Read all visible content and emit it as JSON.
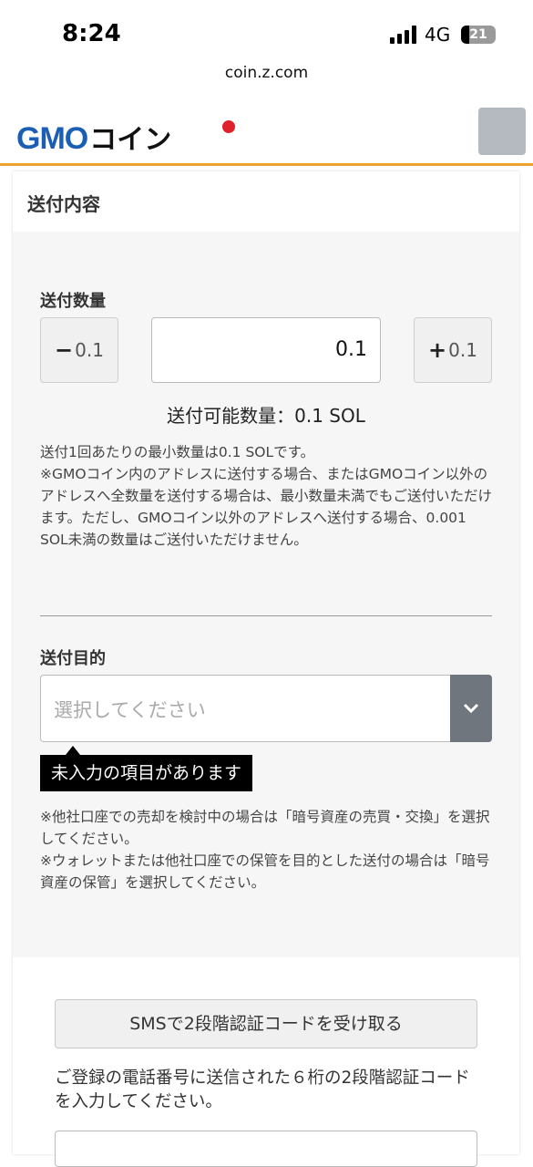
{
  "status_bar": {
    "time": "8:24",
    "network": "4G",
    "battery": "21"
  },
  "browser": {
    "url": "coin.z.com"
  },
  "header": {
    "logo_gmo": "GMO",
    "logo_coin": "コイン"
  },
  "card": {
    "title": "送付内容"
  },
  "quantity": {
    "label": "送付数量",
    "minus_label": "0.1",
    "plus_label": "0.1",
    "value": "0.1",
    "available": "送付可能数量：0.1 SOL"
  },
  "notes": {
    "min_quantity": "送付1回あたりの最小数量は0.1 SOLです。\n※GMOコイン内のアドレスに送付する場合、またはGMOコイン以外のアドレスへ全数量を送付する場合は、最小数量未満でもご送付いただけます。ただし、GMOコイン以外のアドレスへ送付する場合、0.001 SOL未満の数量はご送付いただけません。"
  },
  "purpose": {
    "label": "送付目的",
    "placeholder": "選択してください",
    "error": "未入力の項目があります",
    "note": "※他社口座での売却を検討中の場合は「暗号資産の売買・交換」を選択してください。\n※ウォレットまたは他社口座での保管を目的とした送付の場合は「暗号資産の保管」を選択してください。"
  },
  "sms": {
    "button": "SMSで2段階認証コードを受け取る",
    "instruction": "ご登録の電話番号に送信された６桁の2段階認証コードを入力してください。"
  }
}
